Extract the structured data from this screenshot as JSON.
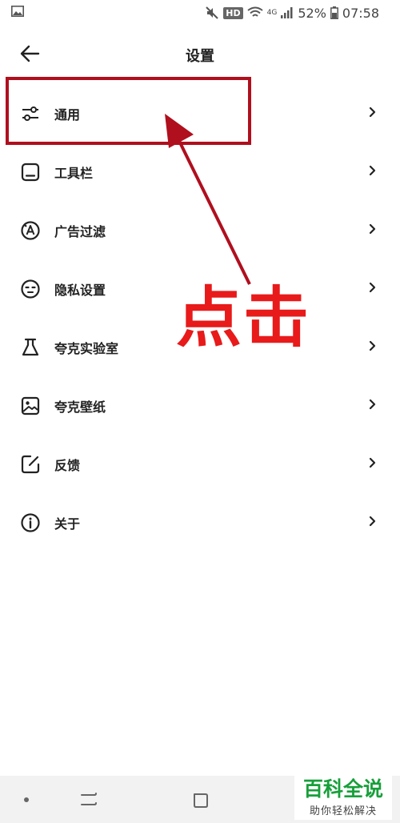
{
  "status_bar": {
    "network": "4G",
    "hd": "HD",
    "battery": "52%",
    "time": "07:58"
  },
  "header": {
    "title": "设置"
  },
  "menu": [
    {
      "label": "通用",
      "icon": "sliders-icon"
    },
    {
      "label": "工具栏",
      "icon": "toolbar-icon"
    },
    {
      "label": "广告过滤",
      "icon": "ad-filter-icon"
    },
    {
      "label": "隐私设置",
      "icon": "privacy-face-icon"
    },
    {
      "label": "夸克实验室",
      "icon": "flask-icon"
    },
    {
      "label": "夸克壁纸",
      "icon": "wallpaper-image-icon"
    },
    {
      "label": "反馈",
      "icon": "feedback-edit-icon"
    },
    {
      "label": "关于",
      "icon": "info-icon"
    }
  ],
  "annotation": {
    "text": "点击",
    "color": "#e81a1a",
    "box_color": "#b00f1e"
  },
  "watermark": {
    "title": "百科全说",
    "subtitle": "助你轻松解决"
  }
}
